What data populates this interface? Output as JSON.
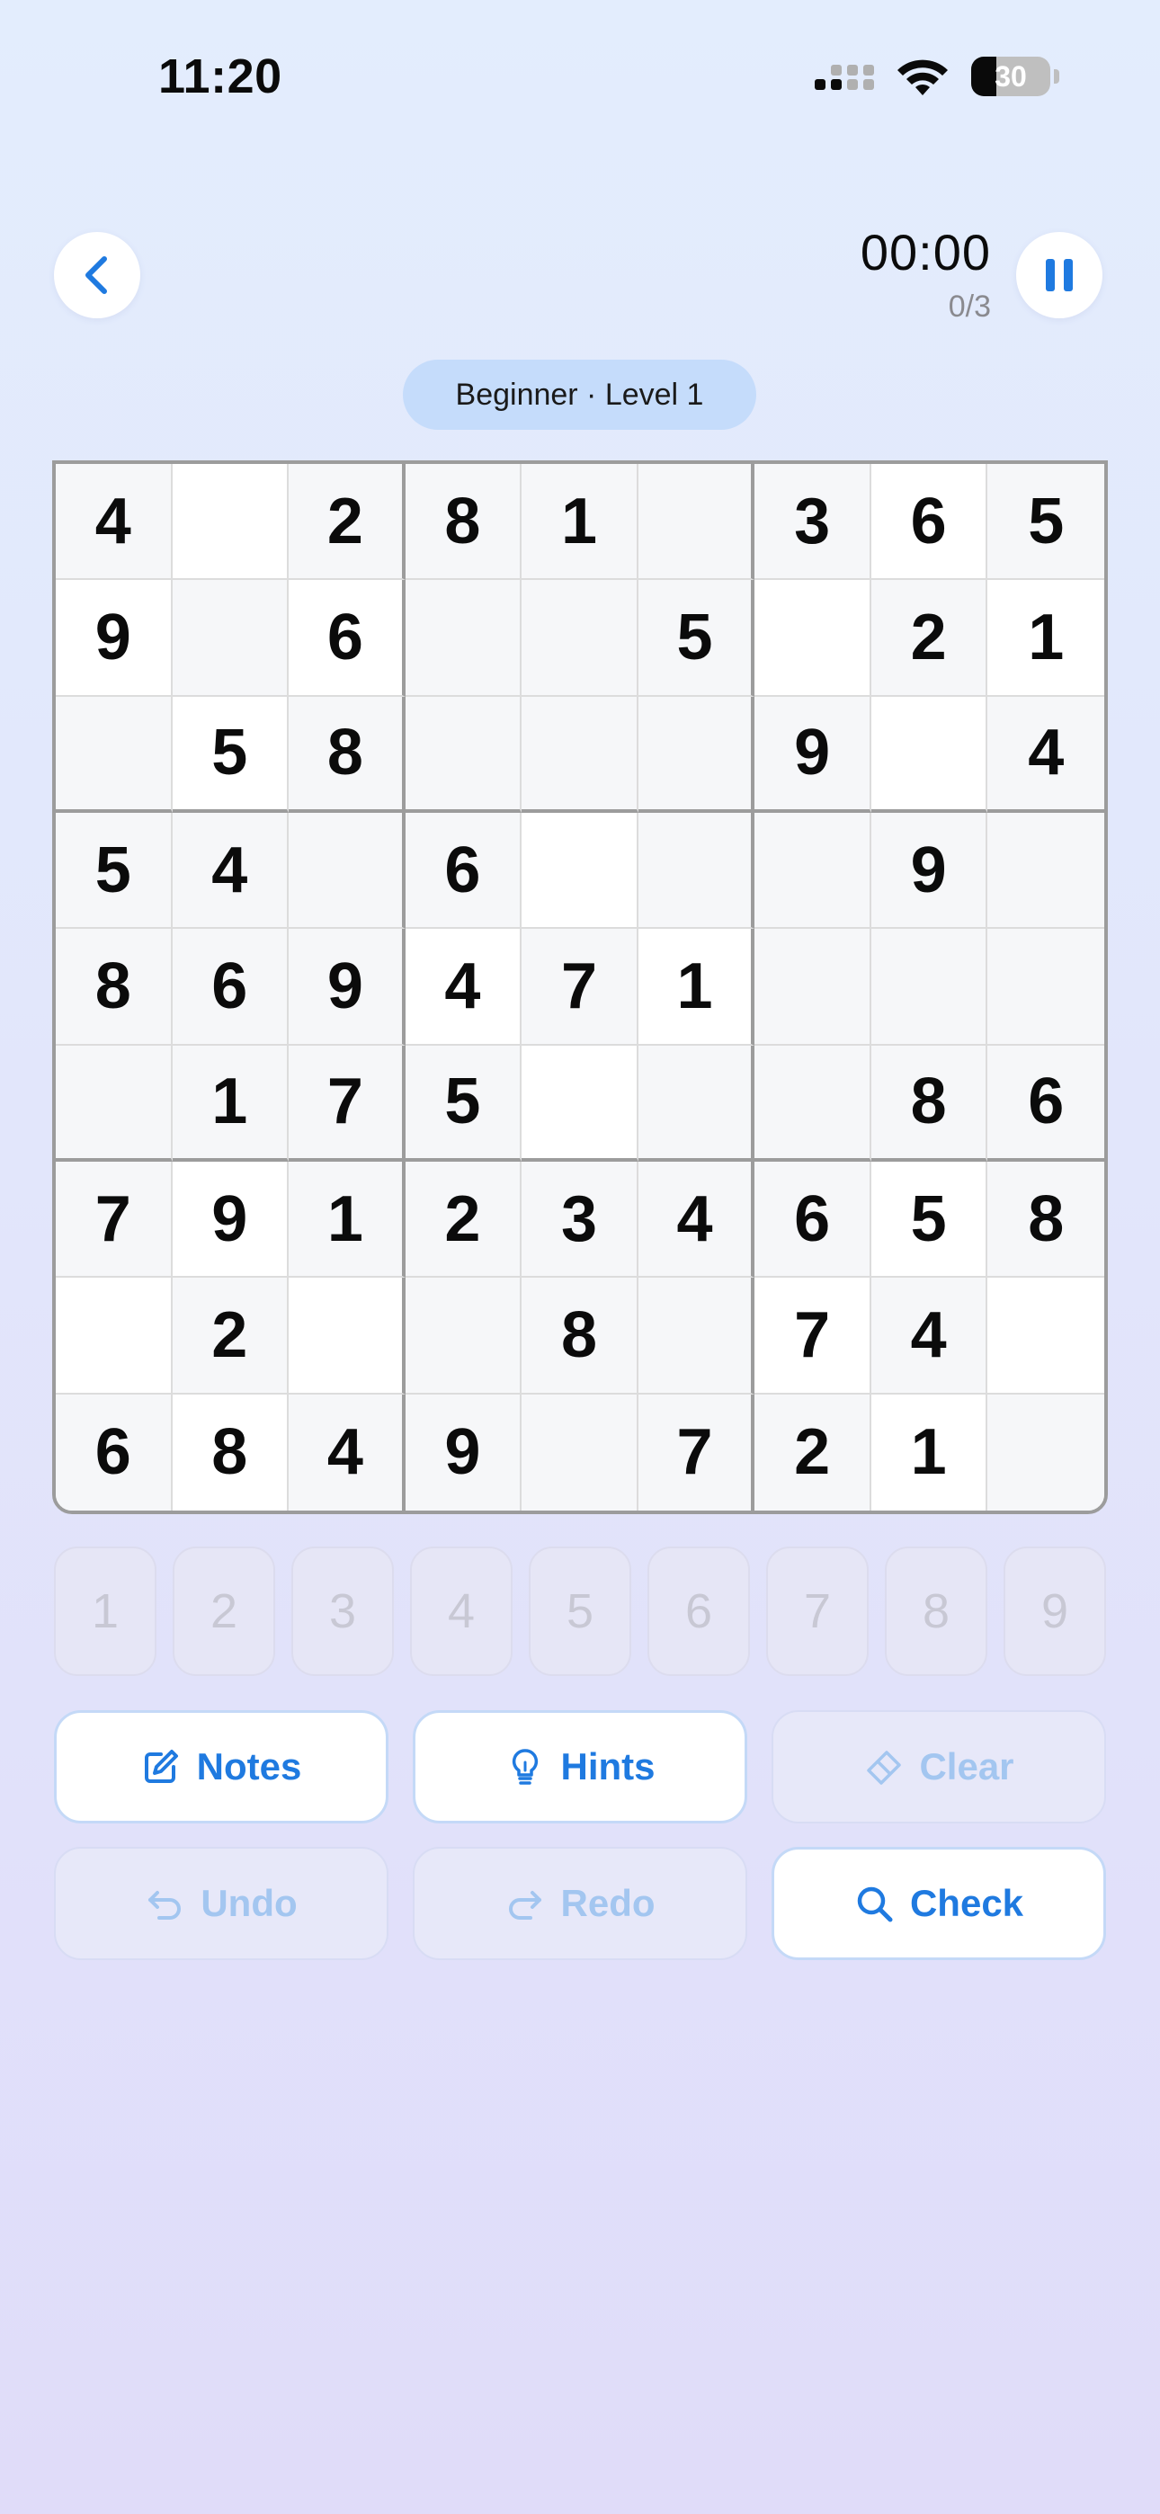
{
  "status_bar": {
    "time": "11:20",
    "battery": "30"
  },
  "header": {
    "back_icon": "chevron-left-icon",
    "timer": "00:00",
    "mistakes": "0/3",
    "pause_icon": "pause-icon"
  },
  "level_label": "Beginner · Level 1",
  "board": [
    [
      "4",
      "",
      "2",
      "8",
      "1",
      "",
      "3",
      "6",
      "5"
    ],
    [
      "9",
      "",
      "6",
      "",
      "",
      "5",
      "",
      "2",
      "1"
    ],
    [
      "",
      "5",
      "8",
      "",
      "",
      "",
      "9",
      "",
      "4"
    ],
    [
      "5",
      "4",
      "",
      "6",
      "",
      "",
      "",
      "9",
      ""
    ],
    [
      "8",
      "6",
      "9",
      "4",
      "7",
      "1",
      "",
      "",
      ""
    ],
    [
      "",
      "1",
      "7",
      "5",
      "",
      "",
      "",
      "8",
      "6"
    ],
    [
      "7",
      "9",
      "1",
      "2",
      "3",
      "4",
      "6",
      "5",
      "8"
    ],
    [
      "",
      "2",
      "",
      "",
      "8",
      "",
      "7",
      "4",
      ""
    ],
    [
      "6",
      "8",
      "4",
      "9",
      "",
      "7",
      "2",
      "1",
      ""
    ]
  ],
  "number_pad": [
    "1",
    "2",
    "3",
    "4",
    "5",
    "6",
    "7",
    "8",
    "9"
  ],
  "actions": [
    {
      "id": "notes",
      "label": "Notes",
      "icon": "edit-icon",
      "enabled": true
    },
    {
      "id": "hints",
      "label": "Hints",
      "icon": "lightbulb-icon",
      "enabled": true
    },
    {
      "id": "clear",
      "label": "Clear",
      "icon": "eraser-icon",
      "enabled": false
    },
    {
      "id": "undo",
      "label": "Undo",
      "icon": "undo-icon",
      "enabled": false
    },
    {
      "id": "redo",
      "label": "Redo",
      "icon": "redo-icon",
      "enabled": false
    },
    {
      "id": "check",
      "label": "Check",
      "icon": "search-icon",
      "enabled": true
    }
  ],
  "colors": {
    "accent": "#1f7ae0",
    "disabled_text": "#a3c6f0",
    "pill_bg": "#c5dcfb"
  }
}
